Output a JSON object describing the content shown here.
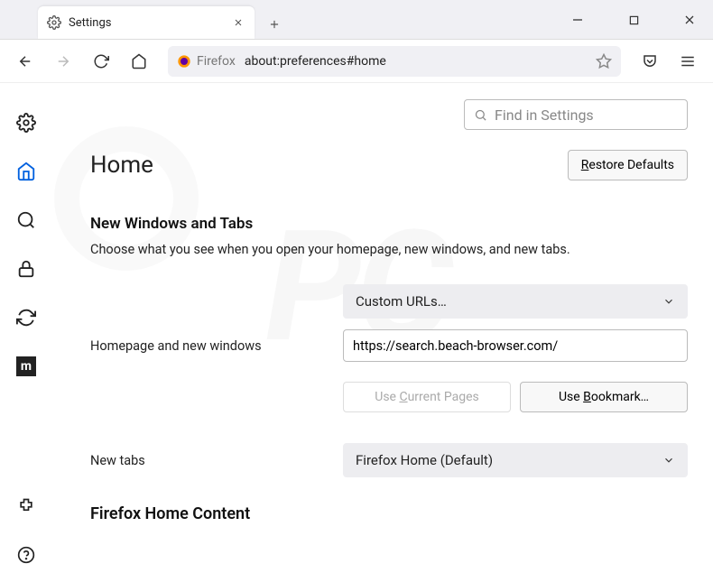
{
  "tab": {
    "title": "Settings"
  },
  "urlbar": {
    "protocol_label": "Firefox",
    "url": "about:preferences#home"
  },
  "search": {
    "placeholder": "Find in Settings"
  },
  "page": {
    "title": "Home",
    "restore_btn": "Restore Defaults",
    "section1": {
      "heading": "New Windows and Tabs",
      "desc": "Choose what you see when you open your homepage, new windows, and new tabs."
    },
    "homepage": {
      "label": "Homepage and new windows",
      "select": "Custom URLs…",
      "value": "https://search.beach-browser.com/",
      "btn_current": "Use Current Pages",
      "btn_bookmark": "Use Bookmark…"
    },
    "newtabs": {
      "label": "New tabs",
      "select": "Firefox Home (Default)"
    },
    "section2": {
      "heading": "Firefox Home Content"
    }
  },
  "sidebar_m": "m"
}
